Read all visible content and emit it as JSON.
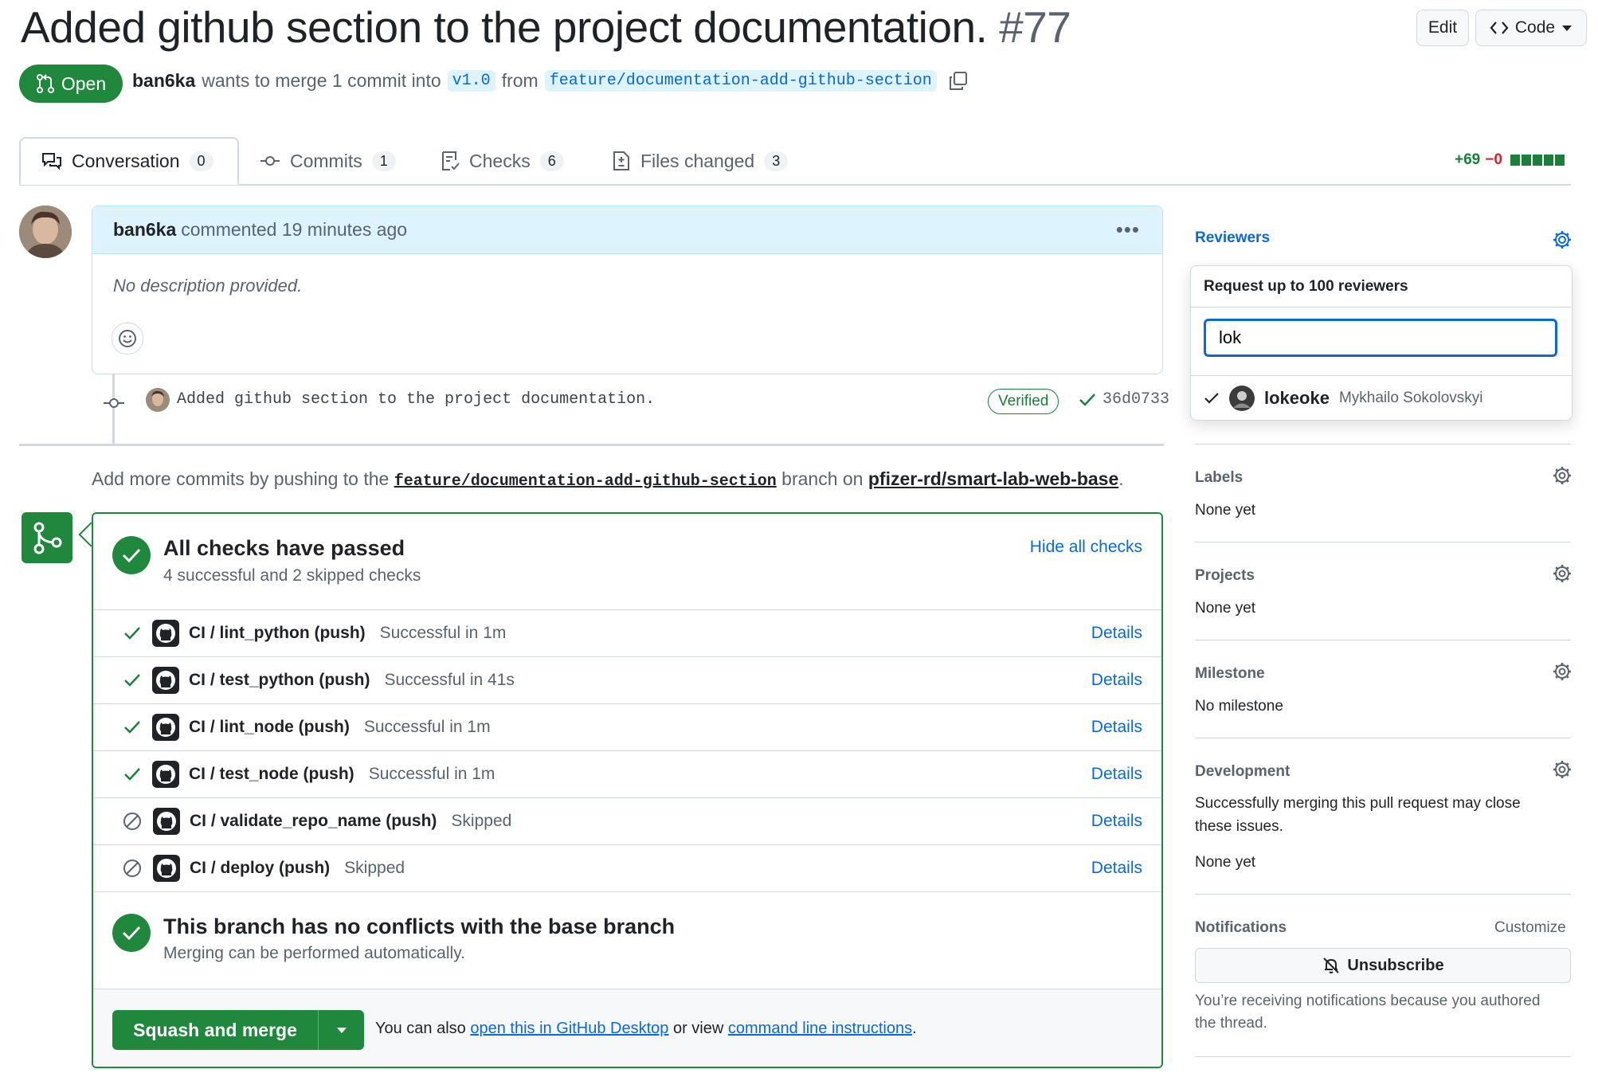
{
  "header": {
    "title": "Added github section to the project documentation.",
    "number": "#77",
    "edit_label": "Edit",
    "code_label": "Code",
    "state_label": "Open",
    "author": "ban6ka",
    "merge_text": "wants to merge 1 commit into",
    "base_branch": "v1.0",
    "from_text": "from",
    "head_branch": "feature/documentation-add-github-section"
  },
  "tabs": [
    {
      "label": "Conversation",
      "count": "0"
    },
    {
      "label": "Commits",
      "count": "1"
    },
    {
      "label": "Checks",
      "count": "6"
    },
    {
      "label": "Files changed",
      "count": "3"
    }
  ],
  "diffstat": {
    "additions": "+69",
    "deletions": "−0"
  },
  "comment": {
    "author": "ban6ka",
    "action": "commented 19 minutes ago",
    "body": "No description provided."
  },
  "commit": {
    "message": "Added github section to the project documentation.",
    "verified_label": "Verified",
    "sha": "36d0733"
  },
  "push_hint": {
    "prefix": "Add more commits by pushing to the",
    "branch": "feature/documentation-add-github-section",
    "middle": "branch on",
    "repo": "pfizer-rd/smart-lab-web-base",
    "suffix": "."
  },
  "checks": {
    "title": "All checks have passed",
    "subtitle": "4 successful and 2 skipped checks",
    "hide_label": "Hide all checks",
    "details_label": "Details",
    "items": [
      {
        "name": "CI / lint_python (push)",
        "status": "Successful in 1m",
        "state": "success"
      },
      {
        "name": "CI / test_python (push)",
        "status": "Successful in 41s",
        "state": "success"
      },
      {
        "name": "CI / lint_node (push)",
        "status": "Successful in 1m",
        "state": "success"
      },
      {
        "name": "CI / test_node (push)",
        "status": "Successful in 1m",
        "state": "success"
      },
      {
        "name": "CI / validate_repo_name (push)",
        "status": "Skipped",
        "state": "skipped"
      },
      {
        "name": "CI / deploy (push)",
        "status": "Skipped",
        "state": "skipped"
      }
    ],
    "conflicts_title": "This branch has no conflicts with the base branch",
    "conflicts_subtitle": "Merging can be performed automatically.",
    "merge_button": "Squash and merge",
    "also_text": "You can also",
    "desktop_link": "open this in GitHub Desktop",
    "or_view": "or view",
    "cli_link": "command line instructions",
    "period": "."
  },
  "sidebar": {
    "reviewers_title": "Reviewers",
    "reviewer_popup": {
      "header": "Request up to 100 reviewers",
      "input_value": "lok",
      "suggestion_login": "lokeoke",
      "suggestion_name": "Mykhailo Sokolovskyi"
    },
    "labels_title": "Labels",
    "labels_value": "None yet",
    "projects_title": "Projects",
    "projects_value": "None yet",
    "milestone_title": "Milestone",
    "milestone_value": "No milestone",
    "development_title": "Development",
    "development_text_1": "Successfully merging this pull request may close",
    "development_text_2": "these issues.",
    "development_value": "None yet",
    "notifications_title": "Notifications",
    "customize_label": "Customize",
    "unsubscribe_label": "Unsubscribe",
    "notification_reason_1": "You’re receiving notifications because you authored",
    "notification_reason_2": "the thread."
  }
}
